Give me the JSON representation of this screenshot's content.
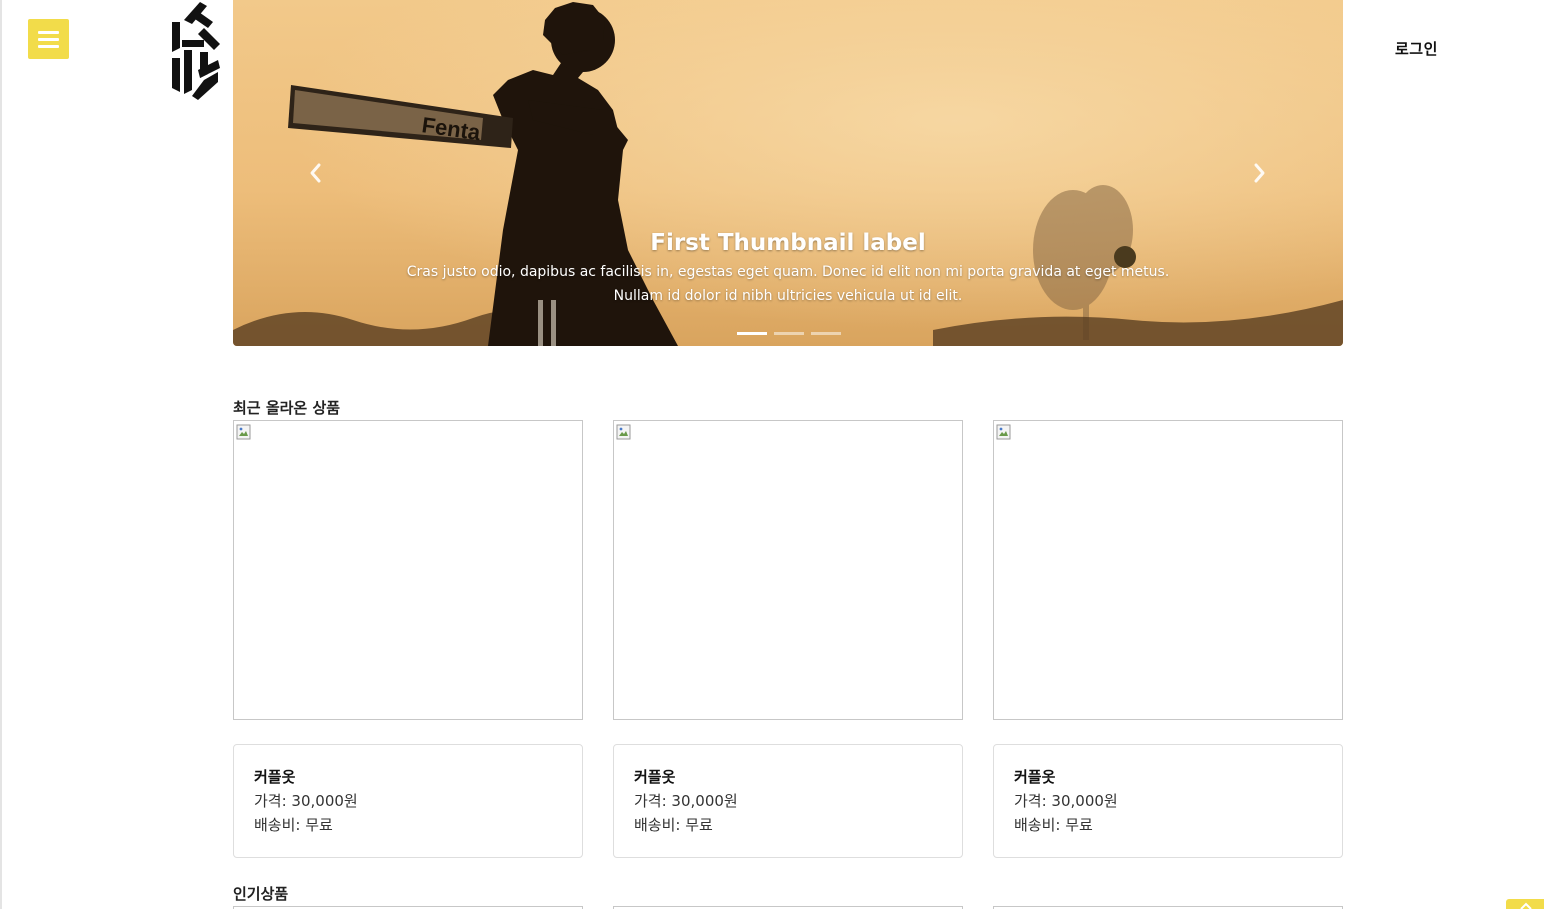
{
  "header": {
    "menu_icon": "hamburger-menu-icon",
    "logo_icon": "brand-logo-icon",
    "login_label": "로그인",
    "accent_color": "#f2dc4a"
  },
  "carousel": {
    "slide_title": "First Thumbnail label",
    "slide_text": "Cras justo odio, dapibus ac facilisis in, egestas eget quam. Donec id elit non mi porta gravida at eget metus. Nullam id dolor id nibh ultricies vehicula ut id elit.",
    "prev_icon": "chevron-left-icon",
    "next_icon": "chevron-right-icon",
    "indicator_count": 3,
    "active_indicator": 1
  },
  "recent": {
    "title": "최근 올라온 상품",
    "products": [
      {
        "name": "커플옷",
        "price": "가격: 30,000원",
        "shipping": "배송비: 무료"
      },
      {
        "name": "커플옷",
        "price": "가격: 30,000원",
        "shipping": "배송비: 무료"
      },
      {
        "name": "커플옷",
        "price": "가격: 30,000원",
        "shipping": "배송비: 무료"
      }
    ]
  },
  "popular": {
    "title": "인기상품"
  },
  "scroll_top_icon": "arrow-up-icon"
}
